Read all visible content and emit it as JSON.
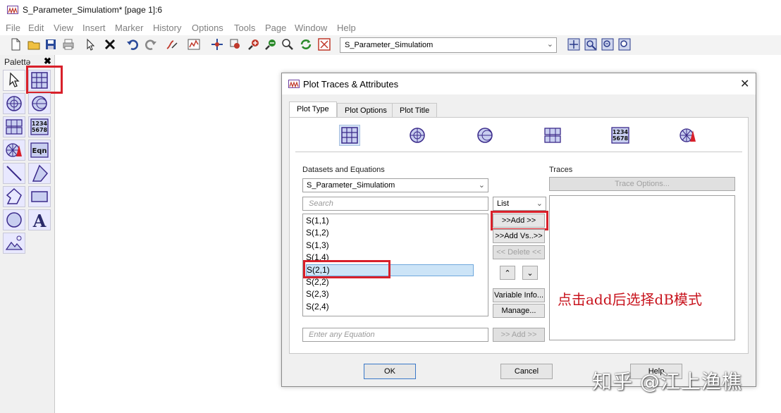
{
  "window": {
    "title": "S_Parameter_Simulatiom* [page 1]:6"
  },
  "menu": [
    "File",
    "Edit",
    "View",
    "Insert",
    "Marker",
    "History",
    "Options",
    "Tools",
    "Page",
    "Window",
    "Help"
  ],
  "toolbar": {
    "document_select": "S_Parameter_Simulatiom"
  },
  "palette": {
    "title": "Palettə",
    "close": "✖",
    "eqn_label": "Eqn",
    "table_label": "1234\n5678"
  },
  "dialog": {
    "title": "Plot Traces & Attributes",
    "close": "✕",
    "tabs": [
      "Plot Type",
      "Plot Options",
      "Plot Title"
    ],
    "datasets_label": "Datasets and Equations",
    "dataset_select": "S_Parameter_Simulatiom",
    "search_placeholder": "Search",
    "list_mode": "List",
    "items": [
      "S(1,1)",
      "S(1,2)",
      "S(1,3)",
      "S(1,4)",
      "S(2,1)",
      "S(2,2)",
      "S(2,3)",
      "S(2,4)"
    ],
    "selected_item": "S(2,1)",
    "add_label": ">>Add >>",
    "add_vs_label": ">>Add Vs..>>",
    "delete_label": "<< Delete <<",
    "variable_info_label": "Variable Info...",
    "manage_label": "Manage...",
    "equation_placeholder": "Enter any Equation",
    "eq_add_label": ">> Add >>",
    "traces_label": "Traces",
    "trace_options_label": "Trace Options...",
    "ok_label": "OK",
    "cancel_label": "Cancel",
    "help_label": "Help"
  },
  "annotation": "点击add后选择dB模式",
  "watermark": "知乎 @江上渔樵",
  "colors": {
    "highlight": "#d8202a",
    "icon_purple": "#3a2a8a",
    "annotation": "#c8141e"
  }
}
